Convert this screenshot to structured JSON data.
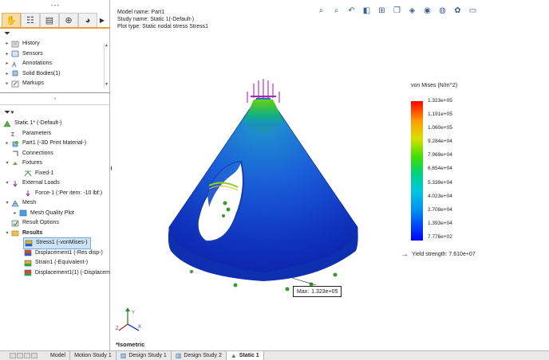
{
  "feature_tree": {
    "items": [
      {
        "label": "History",
        "icon": "history-icon"
      },
      {
        "label": "Sensors",
        "icon": "sensors-icon"
      },
      {
        "label": "Annotations",
        "icon": "annotations-icon"
      },
      {
        "label": "Solid Bodies(1)",
        "icon": "solid-bodies-icon"
      },
      {
        "label": "Markups",
        "icon": "markups-icon"
      }
    ]
  },
  "study_tree": {
    "root": "Static 1* (-Default-)",
    "parameters": "Parameters",
    "part": "Part1 (-3D Print Material-)",
    "connections": "Connections",
    "fixtures": "Fixtures",
    "fixed": "Fixed-1",
    "external_loads": "External Loads",
    "force": "Force-1 (:Per item: -10 lbf:)",
    "mesh": "Mesh",
    "mesh_quality": "Mesh Quality Plot",
    "result_options": "Result Options",
    "results": "Results",
    "result_items": [
      "Stress1 (-vonMises-)",
      "Displacement1 (-Res disp-)",
      "Strain1 (-Equivalent-)",
      "Displacement1(1) (-Displacem"
    ]
  },
  "viewport": {
    "model_name": "Model name: Part1",
    "study_name": "Study name: Static 1(-Default-)",
    "plot_type": "Plot type: Static nodal stress Stress1",
    "view_label": "*Isometric"
  },
  "legend": {
    "title": "von Mises (N/m^2)",
    "ticks": [
      "1.323e+05",
      "1.191e+05",
      "1.060e+05",
      "9.284e+04",
      "7.969e+04",
      "6.654e+04",
      "5.339e+04",
      "4.023e+04",
      "2.708e+04",
      "1.393e+04",
      "7.776e+02"
    ],
    "yield": "Yield strength: 7.610e+07"
  },
  "probe": {
    "label": "Max:",
    "value": "1.323e+05"
  },
  "bottom_tabs": [
    "Model",
    "Motion Study 1",
    "Design Study 1",
    "Design Study 2",
    "Static 1"
  ],
  "colors": {
    "accent": "#f0a030",
    "selection": "#cde3f7",
    "yield_arrow": "#d01010"
  }
}
